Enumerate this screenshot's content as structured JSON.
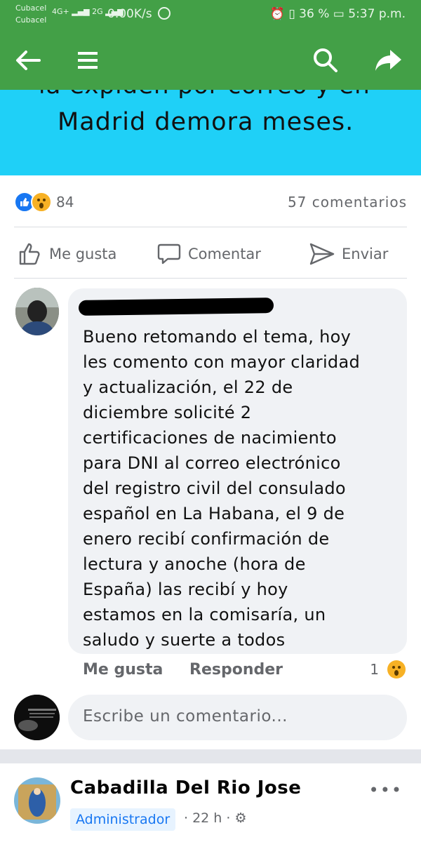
{
  "status_bar": {
    "carrier_1": "Cubacel",
    "carrier_2": "Cubacel",
    "network_1": "4G+",
    "network_2": "2G",
    "speed": "0.00K/s",
    "battery": "36 %",
    "time": "5:37 p.m."
  },
  "app_bar": {
    "back_icon": "arrow-left-icon",
    "menu_icon": "hamburger-icon",
    "search_icon": "search-icon",
    "share_icon": "share-arrow-icon",
    "color": "#43a047"
  },
  "post": {
    "banner_line_1": "la expiden por correo y en",
    "banner_line_2": "Madrid demora meses.",
    "banner_color": "#1fd0f7",
    "reaction_count": "84",
    "comment_count": "57 comentarios",
    "actions": {
      "like": "Me gusta",
      "comment": "Comentar",
      "send": "Enviar"
    }
  },
  "comment": {
    "text": "Bueno retomando el tema, hoy\nles comento con mayor claridad\ny actualización, el 22 de\ndiciembre solicité 2\ncertificaciones de nacimiento\npara DNI al correo electrónico\ndel registro civil del consulado\nespañol en La Habana, el 9 de\nenero recibí confirmación de\nlectura y anoche (hora de\nEspaña) las recibí y hoy\nestamos en la comisaría, un\nsaludo y suerte a todos",
    "like_label": "Me gusta",
    "reply_label": "Responder",
    "reaction_count": "1"
  },
  "composer": {
    "placeholder": "Escribe un comentario..."
  },
  "next_post": {
    "author": "Cabadilla Del Rio Jose",
    "badge": "Administrador",
    "time": "· 22 h ·",
    "more_label": "•••"
  }
}
